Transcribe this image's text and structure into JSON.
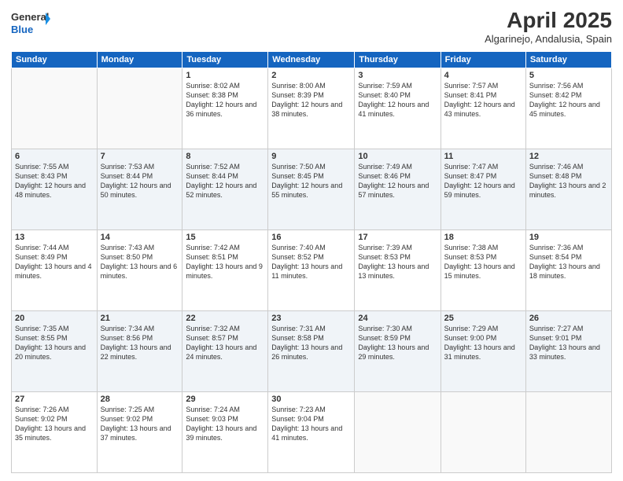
{
  "logo": {
    "line1": "General",
    "line2": "Blue"
  },
  "title": "April 2025",
  "subtitle": "Algarinejo, Andalusia, Spain",
  "days": [
    "Sunday",
    "Monday",
    "Tuesday",
    "Wednesday",
    "Thursday",
    "Friday",
    "Saturday"
  ],
  "weeks": [
    [
      {
        "num": "",
        "sunrise": "",
        "sunset": "",
        "daylight": ""
      },
      {
        "num": "",
        "sunrise": "",
        "sunset": "",
        "daylight": ""
      },
      {
        "num": "1",
        "sunrise": "Sunrise: 8:02 AM",
        "sunset": "Sunset: 8:38 PM",
        "daylight": "Daylight: 12 hours and 36 minutes."
      },
      {
        "num": "2",
        "sunrise": "Sunrise: 8:00 AM",
        "sunset": "Sunset: 8:39 PM",
        "daylight": "Daylight: 12 hours and 38 minutes."
      },
      {
        "num": "3",
        "sunrise": "Sunrise: 7:59 AM",
        "sunset": "Sunset: 8:40 PM",
        "daylight": "Daylight: 12 hours and 41 minutes."
      },
      {
        "num": "4",
        "sunrise": "Sunrise: 7:57 AM",
        "sunset": "Sunset: 8:41 PM",
        "daylight": "Daylight: 12 hours and 43 minutes."
      },
      {
        "num": "5",
        "sunrise": "Sunrise: 7:56 AM",
        "sunset": "Sunset: 8:42 PM",
        "daylight": "Daylight: 12 hours and 45 minutes."
      }
    ],
    [
      {
        "num": "6",
        "sunrise": "Sunrise: 7:55 AM",
        "sunset": "Sunset: 8:43 PM",
        "daylight": "Daylight: 12 hours and 48 minutes."
      },
      {
        "num": "7",
        "sunrise": "Sunrise: 7:53 AM",
        "sunset": "Sunset: 8:44 PM",
        "daylight": "Daylight: 12 hours and 50 minutes."
      },
      {
        "num": "8",
        "sunrise": "Sunrise: 7:52 AM",
        "sunset": "Sunset: 8:44 PM",
        "daylight": "Daylight: 12 hours and 52 minutes."
      },
      {
        "num": "9",
        "sunrise": "Sunrise: 7:50 AM",
        "sunset": "Sunset: 8:45 PM",
        "daylight": "Daylight: 12 hours and 55 minutes."
      },
      {
        "num": "10",
        "sunrise": "Sunrise: 7:49 AM",
        "sunset": "Sunset: 8:46 PM",
        "daylight": "Daylight: 12 hours and 57 minutes."
      },
      {
        "num": "11",
        "sunrise": "Sunrise: 7:47 AM",
        "sunset": "Sunset: 8:47 PM",
        "daylight": "Daylight: 12 hours and 59 minutes."
      },
      {
        "num": "12",
        "sunrise": "Sunrise: 7:46 AM",
        "sunset": "Sunset: 8:48 PM",
        "daylight": "Daylight: 13 hours and 2 minutes."
      }
    ],
    [
      {
        "num": "13",
        "sunrise": "Sunrise: 7:44 AM",
        "sunset": "Sunset: 8:49 PM",
        "daylight": "Daylight: 13 hours and 4 minutes."
      },
      {
        "num": "14",
        "sunrise": "Sunrise: 7:43 AM",
        "sunset": "Sunset: 8:50 PM",
        "daylight": "Daylight: 13 hours and 6 minutes."
      },
      {
        "num": "15",
        "sunrise": "Sunrise: 7:42 AM",
        "sunset": "Sunset: 8:51 PM",
        "daylight": "Daylight: 13 hours and 9 minutes."
      },
      {
        "num": "16",
        "sunrise": "Sunrise: 7:40 AM",
        "sunset": "Sunset: 8:52 PM",
        "daylight": "Daylight: 13 hours and 11 minutes."
      },
      {
        "num": "17",
        "sunrise": "Sunrise: 7:39 AM",
        "sunset": "Sunset: 8:53 PM",
        "daylight": "Daylight: 13 hours and 13 minutes."
      },
      {
        "num": "18",
        "sunrise": "Sunrise: 7:38 AM",
        "sunset": "Sunset: 8:53 PM",
        "daylight": "Daylight: 13 hours and 15 minutes."
      },
      {
        "num": "19",
        "sunrise": "Sunrise: 7:36 AM",
        "sunset": "Sunset: 8:54 PM",
        "daylight": "Daylight: 13 hours and 18 minutes."
      }
    ],
    [
      {
        "num": "20",
        "sunrise": "Sunrise: 7:35 AM",
        "sunset": "Sunset: 8:55 PM",
        "daylight": "Daylight: 13 hours and 20 minutes."
      },
      {
        "num": "21",
        "sunrise": "Sunrise: 7:34 AM",
        "sunset": "Sunset: 8:56 PM",
        "daylight": "Daylight: 13 hours and 22 minutes."
      },
      {
        "num": "22",
        "sunrise": "Sunrise: 7:32 AM",
        "sunset": "Sunset: 8:57 PM",
        "daylight": "Daylight: 13 hours and 24 minutes."
      },
      {
        "num": "23",
        "sunrise": "Sunrise: 7:31 AM",
        "sunset": "Sunset: 8:58 PM",
        "daylight": "Daylight: 13 hours and 26 minutes."
      },
      {
        "num": "24",
        "sunrise": "Sunrise: 7:30 AM",
        "sunset": "Sunset: 8:59 PM",
        "daylight": "Daylight: 13 hours and 29 minutes."
      },
      {
        "num": "25",
        "sunrise": "Sunrise: 7:29 AM",
        "sunset": "Sunset: 9:00 PM",
        "daylight": "Daylight: 13 hours and 31 minutes."
      },
      {
        "num": "26",
        "sunrise": "Sunrise: 7:27 AM",
        "sunset": "Sunset: 9:01 PM",
        "daylight": "Daylight: 13 hours and 33 minutes."
      }
    ],
    [
      {
        "num": "27",
        "sunrise": "Sunrise: 7:26 AM",
        "sunset": "Sunset: 9:02 PM",
        "daylight": "Daylight: 13 hours and 35 minutes."
      },
      {
        "num": "28",
        "sunrise": "Sunrise: 7:25 AM",
        "sunset": "Sunset: 9:02 PM",
        "daylight": "Daylight: 13 hours and 37 minutes."
      },
      {
        "num": "29",
        "sunrise": "Sunrise: 7:24 AM",
        "sunset": "Sunset: 9:03 PM",
        "daylight": "Daylight: 13 hours and 39 minutes."
      },
      {
        "num": "30",
        "sunrise": "Sunrise: 7:23 AM",
        "sunset": "Sunset: 9:04 PM",
        "daylight": "Daylight: 13 hours and 41 minutes."
      },
      {
        "num": "",
        "sunrise": "",
        "sunset": "",
        "daylight": ""
      },
      {
        "num": "",
        "sunrise": "",
        "sunset": "",
        "daylight": ""
      },
      {
        "num": "",
        "sunrise": "",
        "sunset": "",
        "daylight": ""
      }
    ]
  ]
}
